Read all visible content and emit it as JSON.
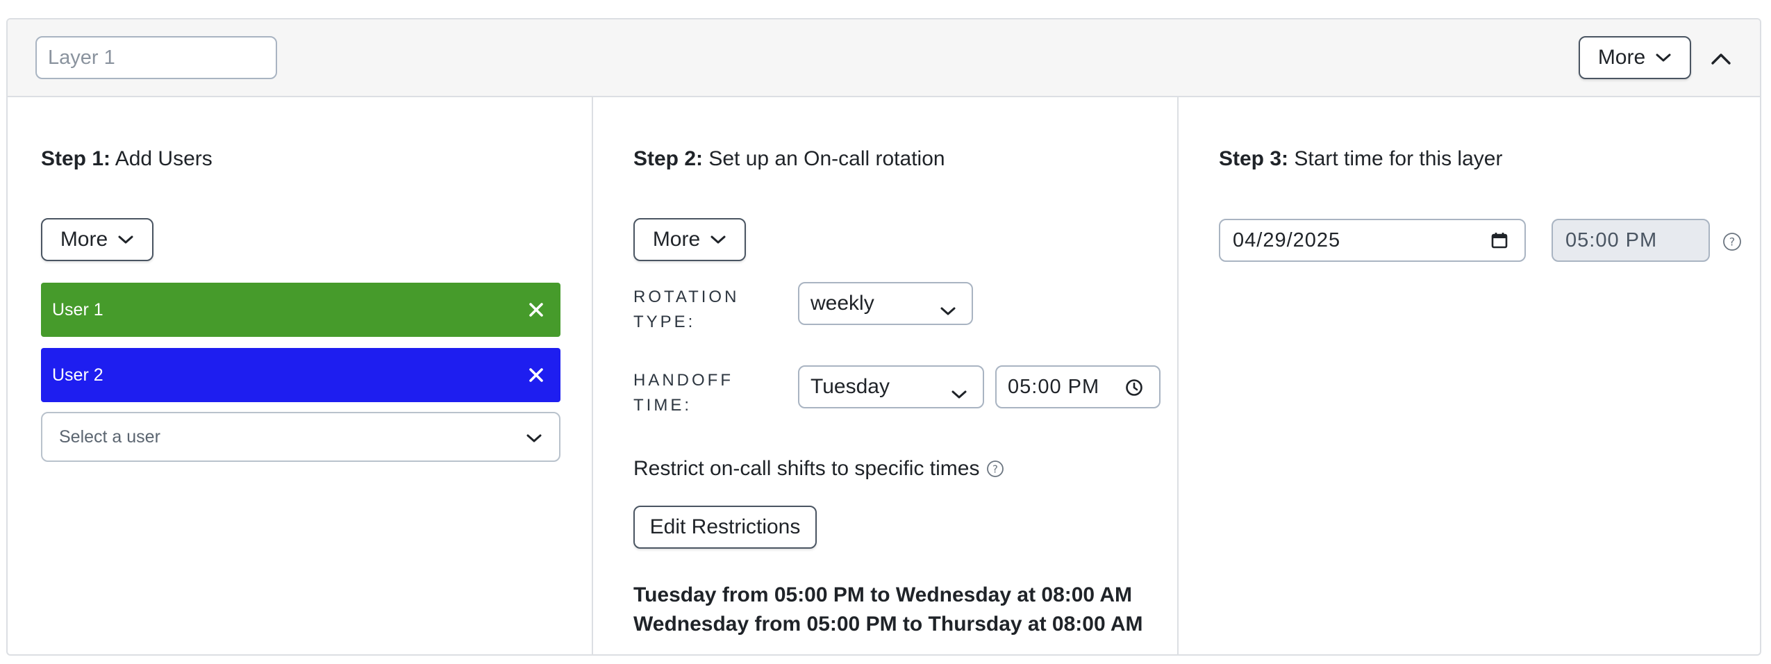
{
  "header": {
    "layer_placeholder": "Layer 1",
    "more_label": "More"
  },
  "step1": {
    "title_bold": "Step 1:",
    "title_rest": " Add Users",
    "more_label": "More",
    "users": [
      {
        "name": "User 1",
        "color": "#469b2b"
      },
      {
        "name": "User 2",
        "color": "#1e1ef0"
      }
    ],
    "select_placeholder": "Select a user"
  },
  "step2": {
    "title_bold": "Step 2:",
    "title_rest": " Set up an On-call rotation",
    "more_label": "More",
    "rotation_label_line1": "Rotation",
    "rotation_label_line2": "type:",
    "rotation_value": "weekly",
    "handoff_label_line1": "Handoff",
    "handoff_label_line2": "time:",
    "handoff_day": "Tuesday",
    "handoff_time": "05:00 PM",
    "restrict_text": "Restrict on-call shifts to specific times",
    "edit_restrictions_label": "Edit Restrictions",
    "restrictions": [
      "Tuesday from 05:00 PM to Wednesday at 08:00 AM",
      "Wednesday from 05:00 PM to Thursday at 08:00 AM"
    ]
  },
  "step3": {
    "title_bold": "Step 3:",
    "title_rest": " Start time for this layer",
    "start_date": "04/29/2025",
    "start_time": "05:00 PM"
  },
  "icons": {
    "chevron": "chevron-down-icon",
    "collapse": "chevron-up-icon",
    "close": "close-icon",
    "help": "help-circle-icon",
    "clock": "clock-icon",
    "calendar": "calendar-icon"
  }
}
